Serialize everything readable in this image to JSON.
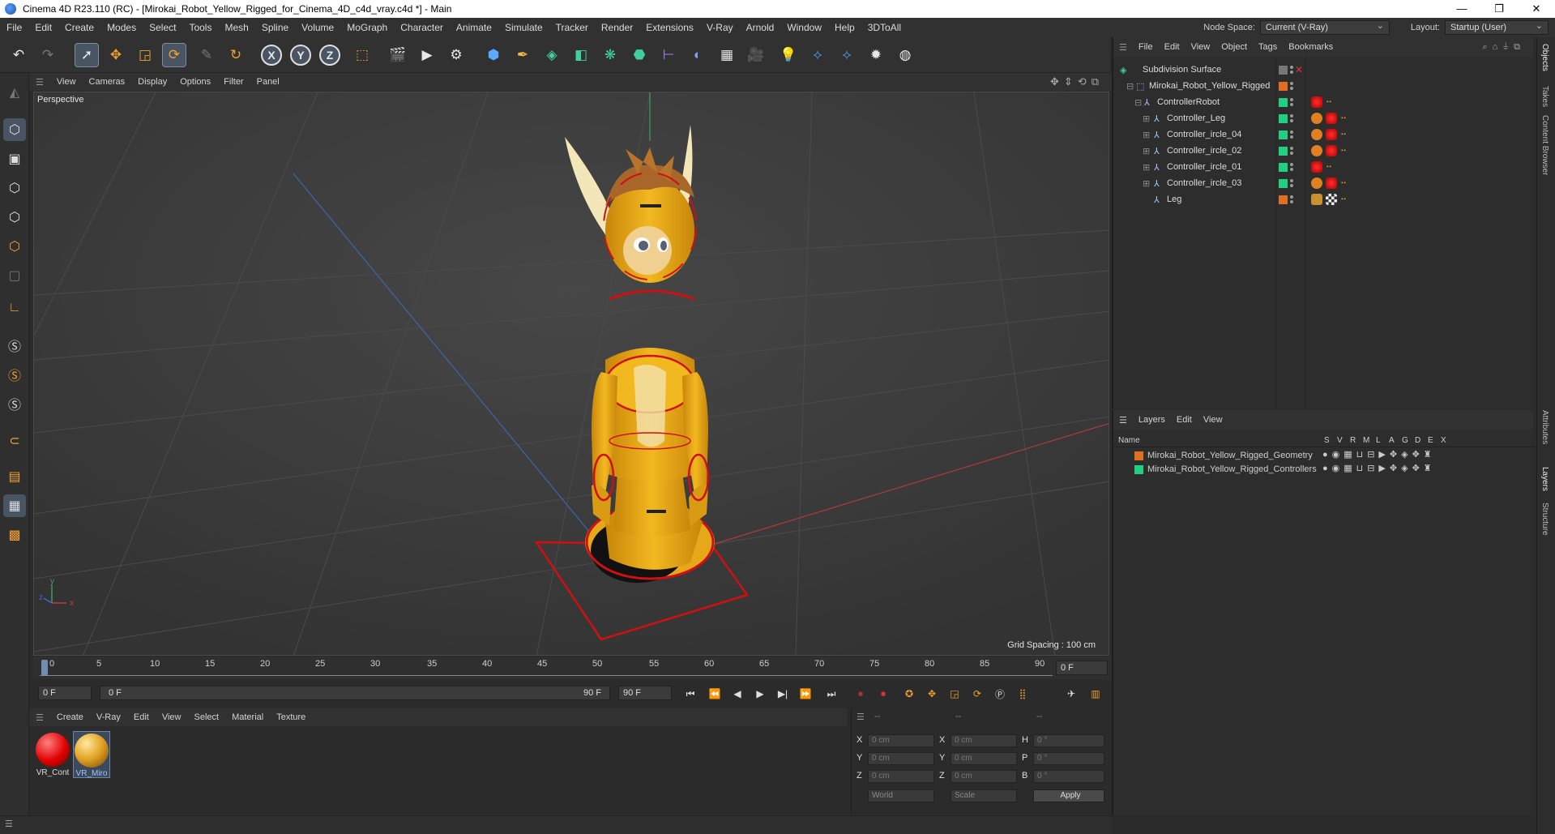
{
  "window": {
    "title": "Cinema 4D R23.110 (RC) - [Mirokai_Robot_Yellow_Rigged_for_Cinema_4D_c4d_vray.c4d *] - Main",
    "controls": [
      "—",
      "❐",
      "✕"
    ]
  },
  "menubar": {
    "items": [
      "File",
      "Edit",
      "Create",
      "Modes",
      "Select",
      "Tools",
      "Mesh",
      "Spline",
      "Volume",
      "MoGraph",
      "Character",
      "Animate",
      "Simulate",
      "Tracker",
      "Render",
      "Extensions",
      "V-Ray",
      "Arnold",
      "Window",
      "Help",
      "3DToAll"
    ],
    "node_space_label": "Node Space:",
    "node_space_value": "Current (V-Ray)",
    "layout_label": "Layout:",
    "layout_value": "Startup (User)"
  },
  "viewport": {
    "menu": [
      "View",
      "Cameras",
      "Display",
      "Options",
      "Filter",
      "Panel"
    ],
    "camera_label": "Perspective",
    "grid_spacing": "Grid Spacing : 100 cm",
    "axis_y": "y",
    "axis_x": "x",
    "axis_z": "z"
  },
  "timeline": {
    "ticks": [
      "0",
      "5",
      "10",
      "15",
      "20",
      "25",
      "30",
      "35",
      "40",
      "45",
      "50",
      "55",
      "60",
      "65",
      "70",
      "75",
      "80",
      "85",
      "90"
    ],
    "current_frame": "0 F",
    "start_field": "0 F",
    "range_start": "0 F",
    "range_end": "90 F",
    "end_field": "90 F"
  },
  "material_manager": {
    "menu": [
      "Create",
      "V-Ray",
      "Edit",
      "View",
      "Select",
      "Material",
      "Texture"
    ],
    "materials": [
      {
        "label": "VR_Cont",
        "color": "#e00000"
      },
      {
        "label": "VR_Miro",
        "color": "#e0a020"
      }
    ]
  },
  "coordinates": {
    "headers": [
      "--",
      "--",
      "--"
    ],
    "rows": [
      {
        "a": "X",
        "av": "0 cm",
        "b": "X",
        "bv": "0 cm",
        "c": "H",
        "cv": "0 °"
      },
      {
        "a": "Y",
        "av": "0 cm",
        "b": "Y",
        "bv": "0 cm",
        "c": "P",
        "cv": "0 °"
      },
      {
        "a": "Z",
        "av": "0 cm",
        "b": "Z",
        "bv": "0 cm",
        "c": "B",
        "cv": "0 °"
      }
    ],
    "mode": "World",
    "type": "Scale",
    "apply": "Apply"
  },
  "object_manager": {
    "menu": [
      "File",
      "Edit",
      "View",
      "Object",
      "Tags",
      "Bookmarks"
    ],
    "objects": [
      {
        "name": "Subdivision Surface"
      },
      {
        "name": "Mirokai_Robot_Yellow_Rigged"
      },
      {
        "name": "ControllerRobot"
      },
      {
        "name": "Controller_Leg"
      },
      {
        "name": "Controller_ircle_04"
      },
      {
        "name": "Controller_ircle_02"
      },
      {
        "name": "Controller_ircle_01"
      },
      {
        "name": "Controller_ircle_03"
      },
      {
        "name": "Leg"
      }
    ]
  },
  "layer_manager": {
    "menu": [
      "Layers",
      "Edit",
      "View"
    ],
    "header_name": "Name",
    "header_cols": [
      "S",
      "V",
      "R",
      "M",
      "L",
      "A",
      "G",
      "D",
      "E",
      "X"
    ],
    "layers": [
      {
        "name": "Mirokai_Robot_Yellow_Rigged_Geometry",
        "color": "#e07020"
      },
      {
        "name": "Mirokai_Robot_Yellow_Rigged_Controllers",
        "color": "#20d080"
      }
    ]
  },
  "side_tabs": [
    "Objects",
    "Takes",
    "Content Browser",
    "Attributes",
    "Layers",
    "Structure"
  ]
}
